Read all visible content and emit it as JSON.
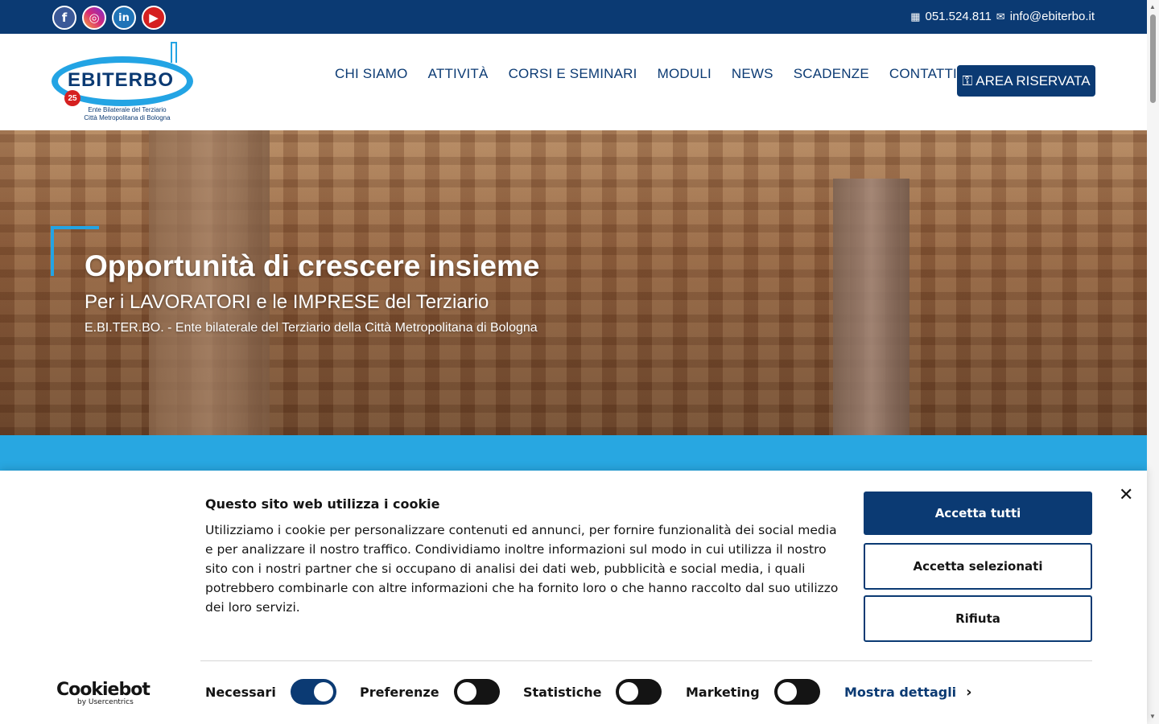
{
  "topbar": {
    "social": [
      {
        "name": "facebook",
        "glyph": "f"
      },
      {
        "name": "instagram",
        "glyph": "◎"
      },
      {
        "name": "linkedin",
        "glyph": "in"
      },
      {
        "name": "youtube",
        "glyph": "▶"
      }
    ],
    "phone_icon": "▦",
    "phone": "051.524.811",
    "email_icon": "✉",
    "email": "info@ebiterbo.it"
  },
  "logo": {
    "brand": "EBITERBO",
    "badge": "25",
    "line1": "Ente Bilaterale del Terziario",
    "line2": "Città Metropolitana di Bologna"
  },
  "nav": {
    "items": [
      "CHI SIAMO",
      "ATTIVITÀ",
      "CORSI E SEMINARI",
      "MODULI",
      "NEWS",
      "SCADENZE",
      "CONTATTI"
    ],
    "reserved_icon": "⚿",
    "reserved": "AREA RISERVATA"
  },
  "hero": {
    "title": "Opportunità di crescere insieme",
    "subtitle": "Per i LAVORATORI e le IMPRESE del Terziario",
    "tagline": "E.BI.TER.BO. - Ente bilaterale del Terziario della Città Metropolitana di Bologna"
  },
  "cookie": {
    "title": "Questo sito web utilizza i cookie",
    "text": "Utilizziamo i cookie per personalizzare contenuti ed annunci, per fornire funzionalità dei social media e per analizzare il nostro traffico. Condividiamo inoltre informazioni sul modo in cui utilizza il nostro sito con i nostri partner che si occupano di analisi dei dati web, pubblicità e social media, i quali potrebbero combinarle con altre informazioni che ha fornito loro o che hanno raccolto dal suo utilizzo dei loro servizi.",
    "close": "✕",
    "accept_all": "Accetta tutti",
    "accept_selected": "Accetta selezionati",
    "reject": "Rifiuta",
    "brand": "Cookiebot",
    "brand_by": "by Usercentrics",
    "toggles": [
      {
        "label": "Necessari",
        "on": true
      },
      {
        "label": "Preferenze",
        "on": false
      },
      {
        "label": "Statistiche",
        "on": false
      },
      {
        "label": "Marketing",
        "on": false
      }
    ],
    "details": "Mostra dettagli",
    "details_chevron": "›"
  },
  "colors": {
    "navy": "#0b3a73",
    "sky": "#28a7e1"
  }
}
